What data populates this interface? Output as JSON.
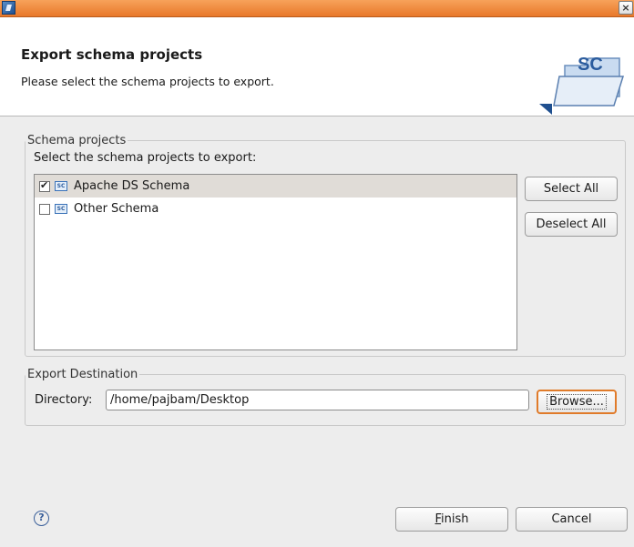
{
  "window": {
    "close_glyph": "×"
  },
  "header": {
    "title": "Export schema projects",
    "subtitle": "Please select the schema projects to export.",
    "banner_text": "SC"
  },
  "schema_projects": {
    "legend": "Schema projects",
    "instruction": "Select the schema projects to export:",
    "items": [
      {
        "label": "Apache DS Schema",
        "checked": true,
        "selected": true,
        "icon_text": "SC"
      },
      {
        "label": "Other Schema",
        "checked": false,
        "selected": false,
        "icon_text": "SC"
      }
    ],
    "select_all_label": "Select All",
    "deselect_all_label": "Deselect All"
  },
  "export_destination": {
    "legend": "Export Destination",
    "directory_label": "Directory:",
    "directory_value": "/home/pajbam/Desktop",
    "browse_label": "Browse..."
  },
  "footer": {
    "help_glyph": "?",
    "finish_mnemonic": "F",
    "finish_rest": "inish",
    "cancel_label": "Cancel"
  },
  "colors": {
    "titlebar": "#f0903f",
    "focus_ring": "#e07b2a",
    "selection": "#e0dcd7"
  }
}
